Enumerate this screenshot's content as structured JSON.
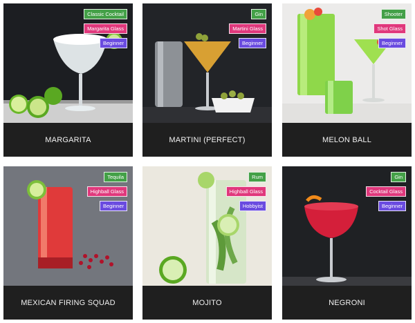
{
  "colors": {
    "spirit_tag": "#43a047",
    "glass_tag": "#e0387c",
    "level_tag": "#6a4be0",
    "caption_bg": "#1f1f1f",
    "caption_text": "#f2f2f2"
  },
  "cards": [
    {
      "name": "MARGARITA",
      "spirit": "Classic Cocktail",
      "glass": "Margarita Glass",
      "level": "Beginner",
      "image": "margarita-photo"
    },
    {
      "name": "MARTINI (PERFECT)",
      "spirit": "Gin",
      "glass": "Martini Glass",
      "level": "Beginner",
      "image": "martini-photo"
    },
    {
      "name": "MELON BALL",
      "spirit": "Shooter",
      "glass": "Shot Glass",
      "level": "Beginner",
      "image": "melon-ball-photo"
    },
    {
      "name": "MEXICAN FIRING SQUAD",
      "spirit": "Tequila",
      "glass": "Highball Glass",
      "level": "Beginner",
      "image": "mexican-firing-squad-photo"
    },
    {
      "name": "MOJITO",
      "spirit": "Rum",
      "glass": "Highball Glass",
      "level": "Hobbyist",
      "image": "mojito-photo"
    },
    {
      "name": "NEGRONI",
      "spirit": "Gin",
      "glass": "Cocktail Glass",
      "level": "Beginner",
      "image": "negroni-photo"
    }
  ]
}
